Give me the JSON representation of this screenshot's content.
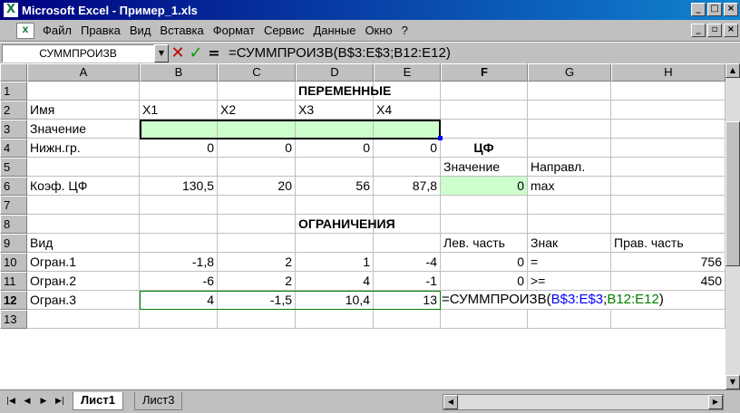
{
  "window": {
    "title": "Microsoft Excel - Пример_1.xls",
    "buttons": [
      "_",
      "□",
      "×"
    ]
  },
  "menu": {
    "items": [
      "Файл",
      "Правка",
      "Вид",
      "Вставка",
      "Формат",
      "Сервис",
      "Данные",
      "Окно",
      "?"
    ],
    "doc_buttons": [
      "_",
      "▫",
      "×"
    ]
  },
  "formula_bar": {
    "name_box": "СУММПРОИЗВ",
    "cancel": "✕",
    "enter": "✓",
    "equals": "=",
    "formula": "=СУММПРОИЗВ(B$3:E$3;B12:E12)"
  },
  "columns": [
    "A",
    "B",
    "C",
    "D",
    "E",
    "F",
    "G",
    "H"
  ],
  "rows": [
    "1",
    "2",
    "3",
    "4",
    "5",
    "6",
    "7",
    "8",
    "9",
    "10",
    "11",
    "12",
    "13"
  ],
  "cells": {
    "D1": "ПЕРЕМЕННЫЕ",
    "A2": "Имя",
    "B2": "X1",
    "C2": "X2",
    "D2": "X3",
    "E2": "X4",
    "A3": "Значение",
    "A4": "Нижн.гр.",
    "B4": "0",
    "C4": "0",
    "D4": "0",
    "E4": "0",
    "F4": "ЦФ",
    "F5": "Значение",
    "G5": "Направл.",
    "A6": "Коэф. ЦФ",
    "B6": "130,5",
    "C6": "20",
    "D6": "56",
    "E6": "87,8",
    "F6": "0",
    "G6": "max",
    "D8": "ОГРАНИЧЕНИЯ",
    "A9": "Вид",
    "F9": "Лев. часть",
    "G9": "Знак",
    "H9": "Прав. часть",
    "A10": "Огран.1",
    "B10": "-1,8",
    "C10": "2",
    "D10": "1",
    "E10": "-4",
    "F10": "0",
    "G10": "=",
    "H10": "756",
    "A11": "Огран.2",
    "B11": "-6",
    "C11": "2",
    "D11": "4",
    "E11": "-1",
    "F11": "0",
    "G11": ">=",
    "H11": "450",
    "A12": "Огран.3",
    "B12": "4",
    "C12": "-1,5",
    "D12": "10,4",
    "E12": "13"
  },
  "editing_formula": {
    "prefix": "=СУММПРОИЗВ(",
    "ref1": "B$3:E$3",
    "sep": ";",
    "ref2": "B12:E12",
    "suffix": ")"
  },
  "sheets": {
    "tabs": [
      "Лист1",
      "Лист3"
    ],
    "active": "Лист1",
    "nav": [
      "|◀",
      "◀",
      "▶",
      "▶|"
    ]
  },
  "colors": {
    "title_bar": "#000080",
    "input_cells": "#ccffcc",
    "ref1_color": "#0000ff",
    "ref2_color": "#008000"
  }
}
